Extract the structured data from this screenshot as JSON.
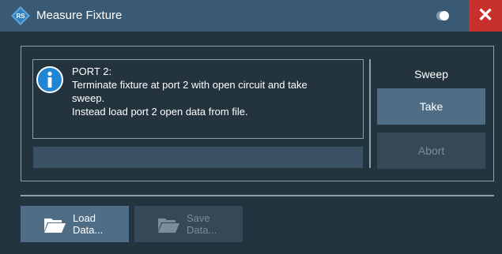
{
  "window": {
    "title": "Measure Fixture",
    "close_symbol": "✕"
  },
  "message": {
    "icon": "info-icon",
    "lines": [
      "PORT 2:",
      "Terminate fixture at port 2 with open circuit and take",
      "sweep.",
      "Instead load port 2 open data from file."
    ]
  },
  "progress": {
    "value": 0
  },
  "sweep": {
    "label": "Sweep",
    "take_label": "Take",
    "abort_label": "Abort"
  },
  "footer": {
    "load": {
      "line1": "Load",
      "line2": "Data...",
      "icon": "folder-open-icon"
    },
    "save": {
      "line1": "Save",
      "line2": "Data...",
      "icon": "folder-open-icon"
    }
  },
  "colors": {
    "dialog_bg": "#24343f",
    "titlebar_bg": "#3a5a74",
    "close_bg": "#c8302e",
    "button_bg": "#4f6e85",
    "button_disabled_bg": "#344858",
    "info_icon": "#1f86d6"
  }
}
